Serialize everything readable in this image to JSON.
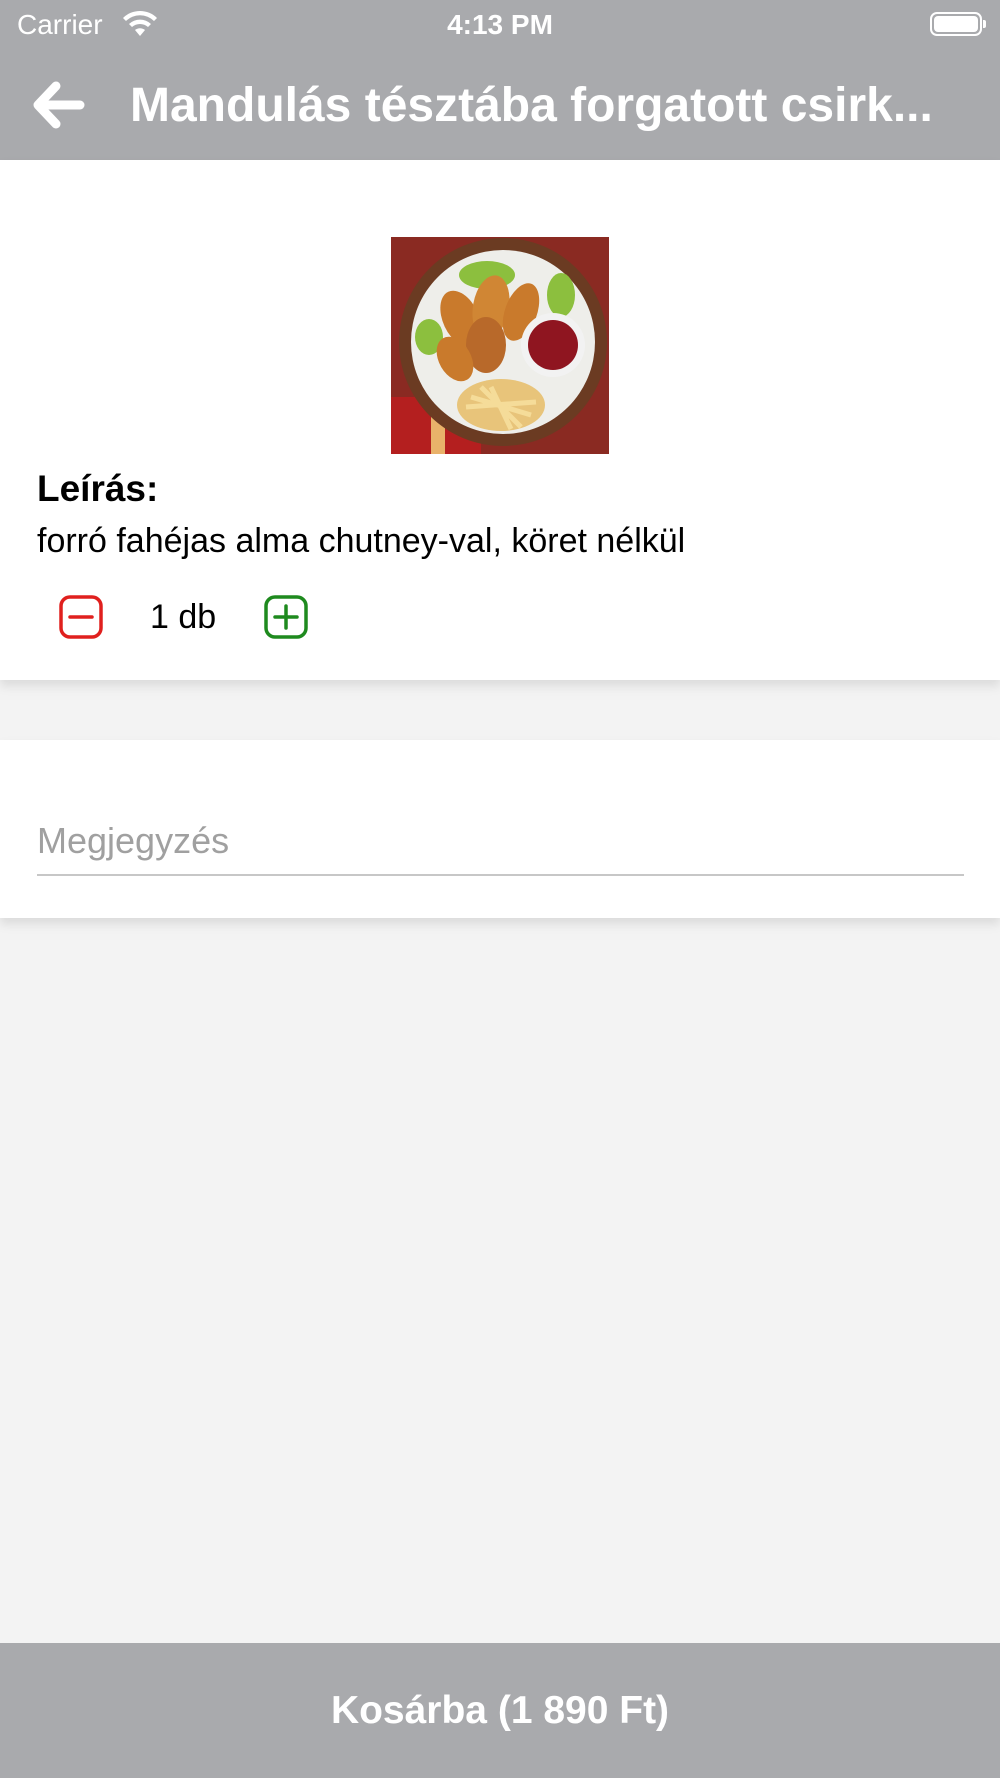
{
  "status_bar": {
    "carrier": "Carrier",
    "time": "4:13 PM"
  },
  "header": {
    "back_icon": "arrow-left-icon",
    "title": "Mandulás tésztába forgatott csirk..."
  },
  "product": {
    "image_icon": "fried-chicken-plate-image",
    "description_label": "Leírás:",
    "description": "forró fahéjas alma chutney-val, köret nélkül",
    "quantity_text": "1 db",
    "minus_icon": "minus-square-icon",
    "plus_icon": "plus-square-icon"
  },
  "note": {
    "placeholder": "Megjegyzés",
    "value": ""
  },
  "cart_button": {
    "label": "Kosárba (1 890 Ft)"
  },
  "colors": {
    "header_bg": "#a9aaad",
    "page_bg": "#f3f3f3",
    "minus": "#e0201e",
    "plus": "#1e8a1e"
  }
}
